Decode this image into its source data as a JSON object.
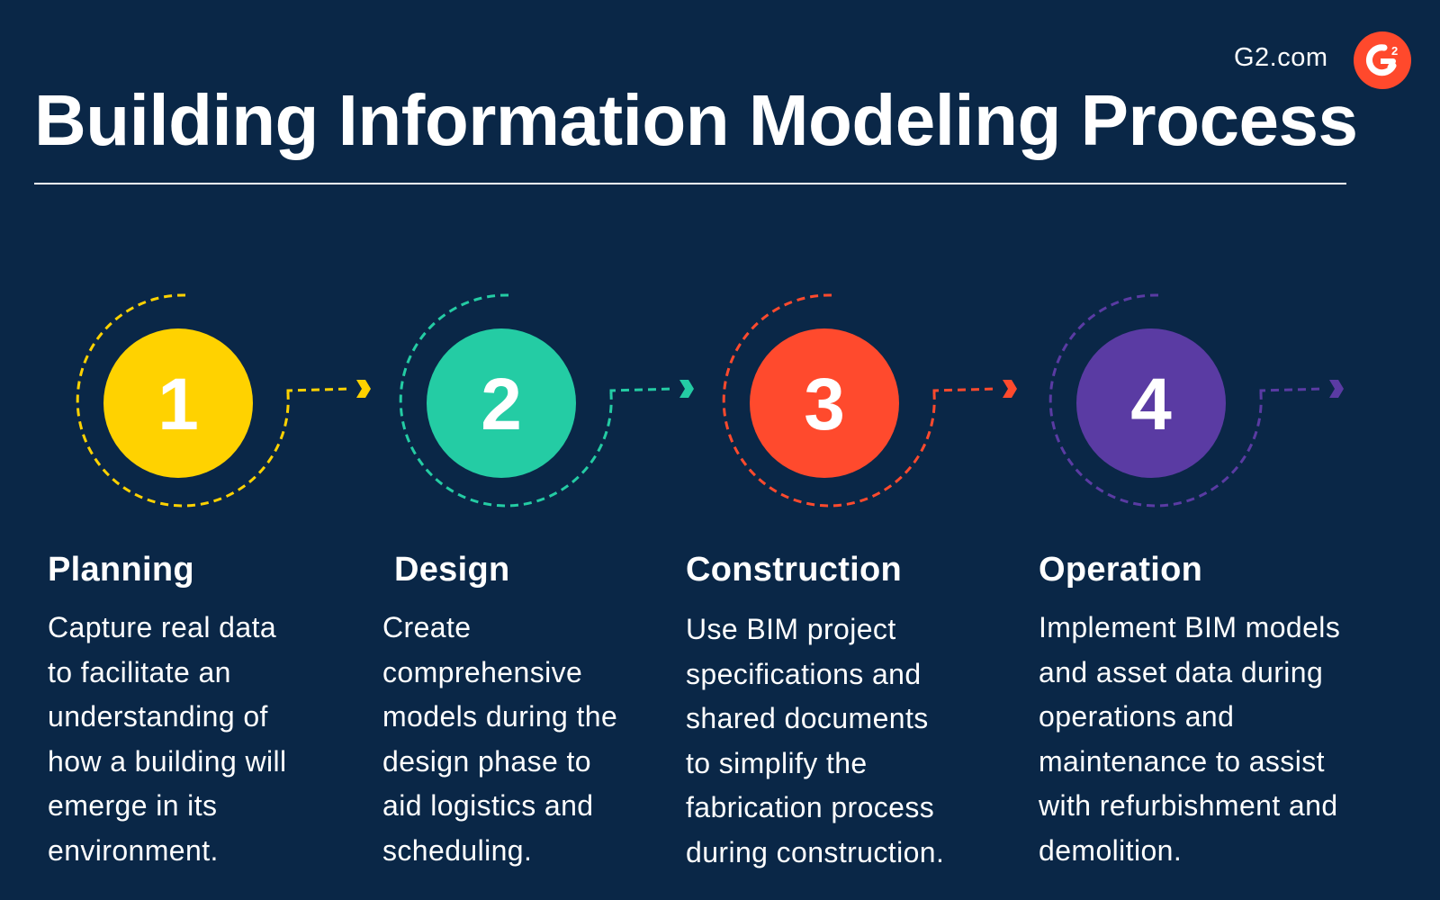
{
  "brand": {
    "site": "G2.com",
    "logo_icon": "g2-logo-icon",
    "logo_mark": "2",
    "logo_color": "#ff492c"
  },
  "title": "Building Information Modeling Process",
  "colors": {
    "background": "#0a2747",
    "text": "#ffffff"
  },
  "steps": [
    {
      "number": "1",
      "heading": "Planning",
      "color": "#ffd200",
      "description": "Capture real data\nto facilitate an\nunderstanding of\nhow a building will\nemerge in its\nenvironment."
    },
    {
      "number": "2",
      "heading": "Design",
      "color": "#24cca4",
      "description": "Create\ncomprehensive\nmodels during the\ndesign phase to\naid logistics and\nscheduling."
    },
    {
      "number": "3",
      "heading": "Construction",
      "color": "#ff4a2d",
      "description": "Use BIM project\nspecifications and\nshared documents\nto simplify the\nfabrication process\nduring construction."
    },
    {
      "number": "4",
      "heading": "Operation",
      "color": "#5a3ba3",
      "description": "Implement BIM  models\nand asset data during\noperations and\nmaintenance to assist\nwith refurbishment and\ndemolition."
    }
  ]
}
